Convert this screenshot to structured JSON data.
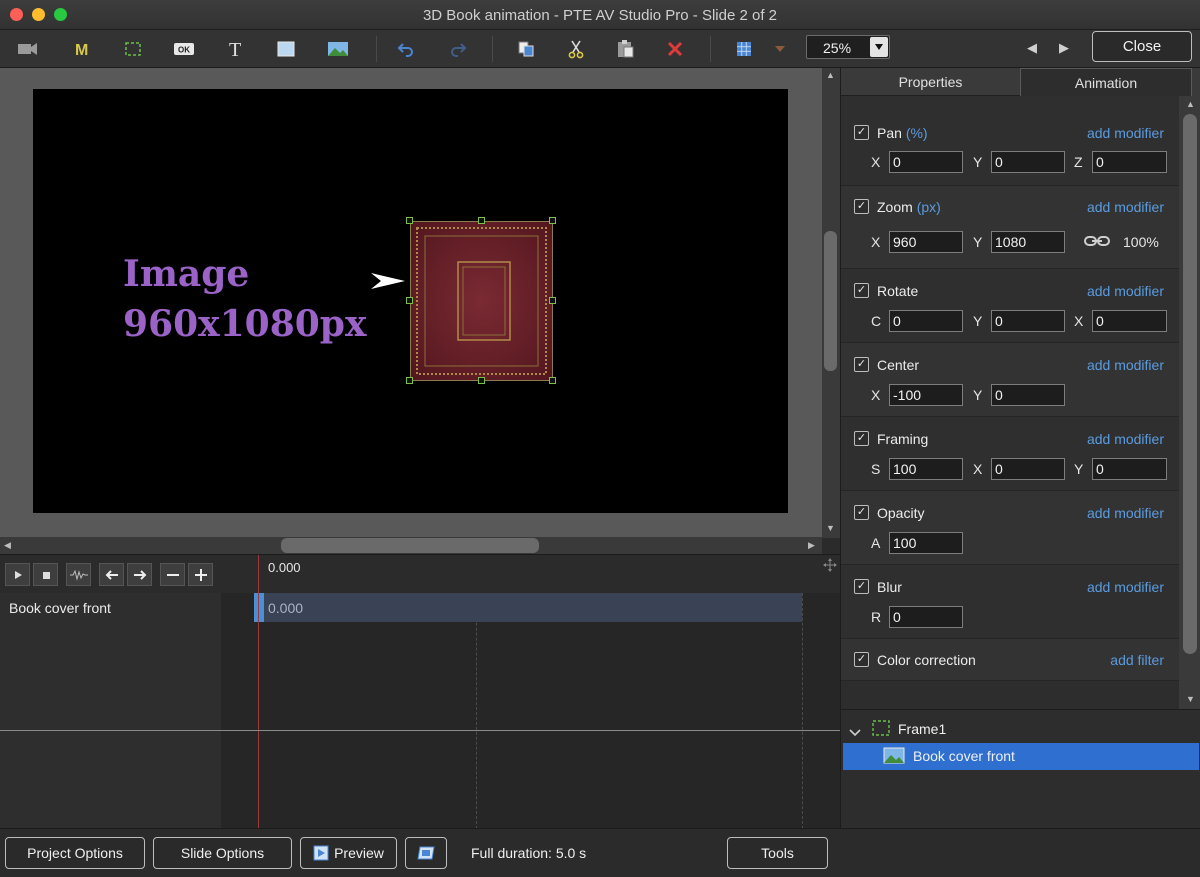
{
  "window": {
    "title": "3D Book animation - PTE AV Studio Pro - Slide 2 of 2"
  },
  "toolbar": {
    "zoom_value": "25%",
    "close_label": "Close",
    "icons": [
      "camera-icon",
      "mask-icon",
      "frame-icon",
      "button-icon",
      "text-icon",
      "rectangle-icon",
      "image-icon",
      "undo-icon",
      "redo-icon",
      "copy-icon",
      "cut-icon",
      "paste-icon",
      "delete-icon",
      "grid-icon",
      "grid-menu-icon"
    ]
  },
  "canvas": {
    "image_label_line1": "Image",
    "image_label_line2": "960x1080px",
    "colors": {
      "label": "#9b63c8",
      "book": "#6e2430"
    }
  },
  "timeline": {
    "ruler_time": "0.000",
    "track_name": "Book cover front",
    "track_time": "0.000"
  },
  "bottom": {
    "project_options": "Project Options",
    "slide_options": "Slide Options",
    "preview": "Preview",
    "full_duration": "Full duration: 5.0 s",
    "tools": "Tools"
  },
  "panel": {
    "tab_properties": "Properties",
    "tab_animation": "Animation",
    "pan": {
      "name": "Pan",
      "unit": "(%)",
      "modifier": "add modifier",
      "x_label": "X",
      "x": "0",
      "y_label": "Y",
      "y": "0",
      "z_label": "Z",
      "z": "0"
    },
    "zoom": {
      "name": "Zoom",
      "unit": "(px)",
      "modifier": "add modifier",
      "x_label": "X",
      "x": "960",
      "y_label": "Y",
      "y": "1080",
      "percent": "100%"
    },
    "rotate": {
      "name": "Rotate",
      "modifier": "add modifier",
      "c_label": "C",
      "c": "0",
      "y_label": "Y",
      "y": "0",
      "x_label": "X",
      "x": "0"
    },
    "center": {
      "name": "Center",
      "modifier": "add modifier",
      "x_label": "X",
      "x": "-100",
      "y_label": "Y",
      "y": "0"
    },
    "framing": {
      "name": "Framing",
      "modifier": "add modifier",
      "s_label": "S",
      "s": "100",
      "x_label": "X",
      "x": "0",
      "y_label": "Y",
      "y": "0"
    },
    "opacity": {
      "name": "Opacity",
      "modifier": "add modifier",
      "a_label": "A",
      "a": "100"
    },
    "blur": {
      "name": "Blur",
      "modifier": "add modifier",
      "r_label": "R",
      "r": "0"
    },
    "color_correction": {
      "name": "Color correction",
      "modifier": "add filter"
    }
  },
  "tree": {
    "frame_label": "Frame1",
    "item_label": "Book cover front"
  }
}
